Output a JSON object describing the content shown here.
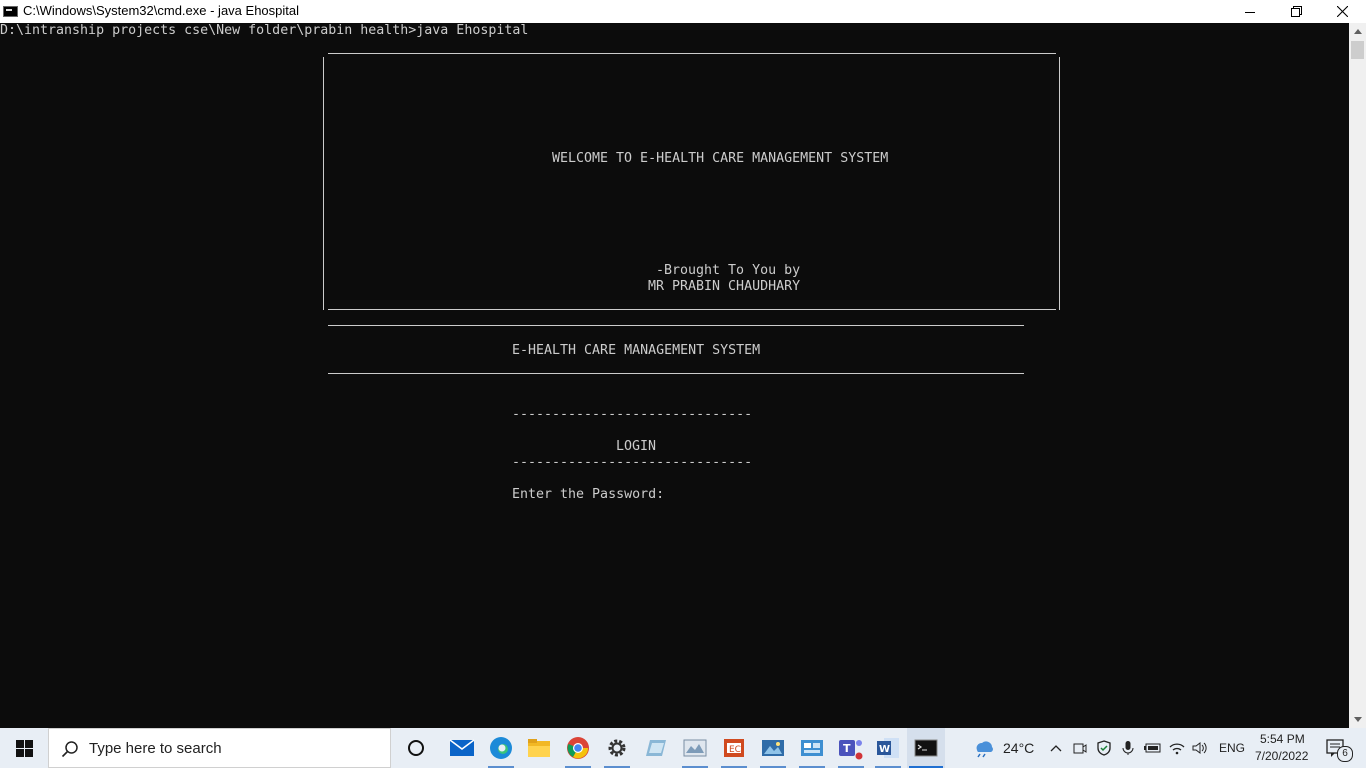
{
  "window": {
    "title": "C:\\Windows\\System32\\cmd.exe - java  Ehospital"
  },
  "console": {
    "prompt_line": "D:\\intranship projects cse\\New folder\\prabin health>java Ehospital",
    "welcome_text": "WELCOME TO E-HEALTH CARE MANAGEMENT SYSTEM",
    "brought_by": "-Brought To You by",
    "author": "MR PRABIN CHAUDHARY",
    "system_title": "E-HEALTH CARE MANAGEMENT SYSTEM",
    "dash_line": "------------------------------",
    "login_label": "LOGIN",
    "password_prompt": "Enter the Password:"
  },
  "taskbar": {
    "search_placeholder": "Type here to search",
    "weather": "24°C",
    "language": "ENG",
    "time": "5:54 PM",
    "date": "7/20/2022",
    "notification_count": "6",
    "pinned_apps": [
      "cortana",
      "mail",
      "edge",
      "file-explorer",
      "chrome",
      "settings",
      "app",
      "app",
      "app",
      "photos",
      "app",
      "teams",
      "word",
      "command-prompt"
    ]
  },
  "colors": {
    "console_bg": "#0c0c0c",
    "console_text": "#cccccc",
    "taskbar_bg": "#e8eef5",
    "accent": "#0078d7"
  }
}
